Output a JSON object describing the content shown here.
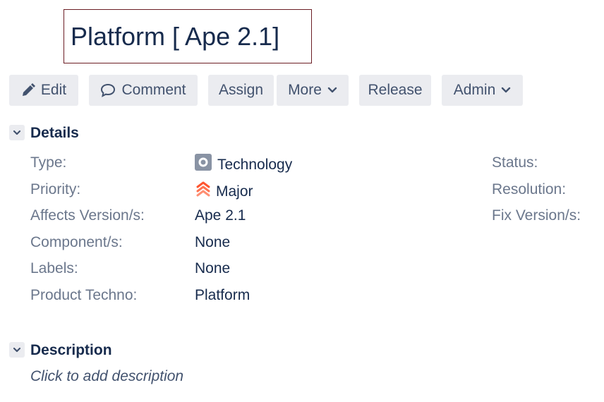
{
  "issue": {
    "title": "Platform [ Ape 2.1]"
  },
  "toolbar": {
    "edit_label": "Edit",
    "comment_label": "Comment",
    "assign_label": "Assign",
    "more_label": "More",
    "release_label": "Release",
    "admin_label": "Admin"
  },
  "details": {
    "heading": "Details",
    "left": [
      {
        "label": "Type:",
        "value": "Technology",
        "icon": "technology-type-icon"
      },
      {
        "label": "Priority:",
        "value": "Major",
        "icon": "priority-major-icon"
      },
      {
        "label": "Affects Version/s:",
        "value": "Ape 2.1"
      },
      {
        "label": "Component/s:",
        "value": "None"
      },
      {
        "label": "Labels:",
        "value": "None"
      },
      {
        "label": "Product Techno:",
        "value": "Platform"
      }
    ],
    "right": [
      {
        "label": "Status:"
      },
      {
        "label": "Resolution:"
      },
      {
        "label": "Fix Version/s:"
      }
    ]
  },
  "description": {
    "heading": "Description",
    "placeholder": "Click to add description"
  },
  "colors": {
    "title_border": "#6b1d24",
    "button_bg": "#ebecf0",
    "priority_major": "#ff5630",
    "type_icon_bg": "#8993a4"
  }
}
